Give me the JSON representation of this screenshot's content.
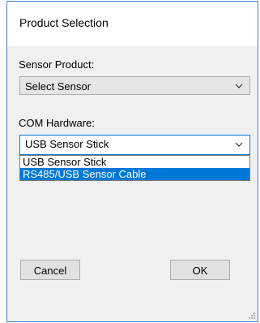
{
  "window": {
    "title": "Product Selection"
  },
  "sensor_product": {
    "label": "Sensor Product:",
    "selected": "Select Sensor"
  },
  "com_hardware": {
    "label": "COM Hardware:",
    "selected": "USB Sensor Stick",
    "options": [
      "USB Sensor Stick",
      "RS485/USB Sensor Cable"
    ],
    "highlighted_index": 1
  },
  "buttons": {
    "cancel_label": "Cancel",
    "ok_label": "OK"
  },
  "icons": {
    "dropdown_arrow": "chevron-down-icon",
    "resize_grip": "resize-grip-icon"
  },
  "colors": {
    "accent": "#0078d7",
    "window_border": "#3f7fcf"
  }
}
